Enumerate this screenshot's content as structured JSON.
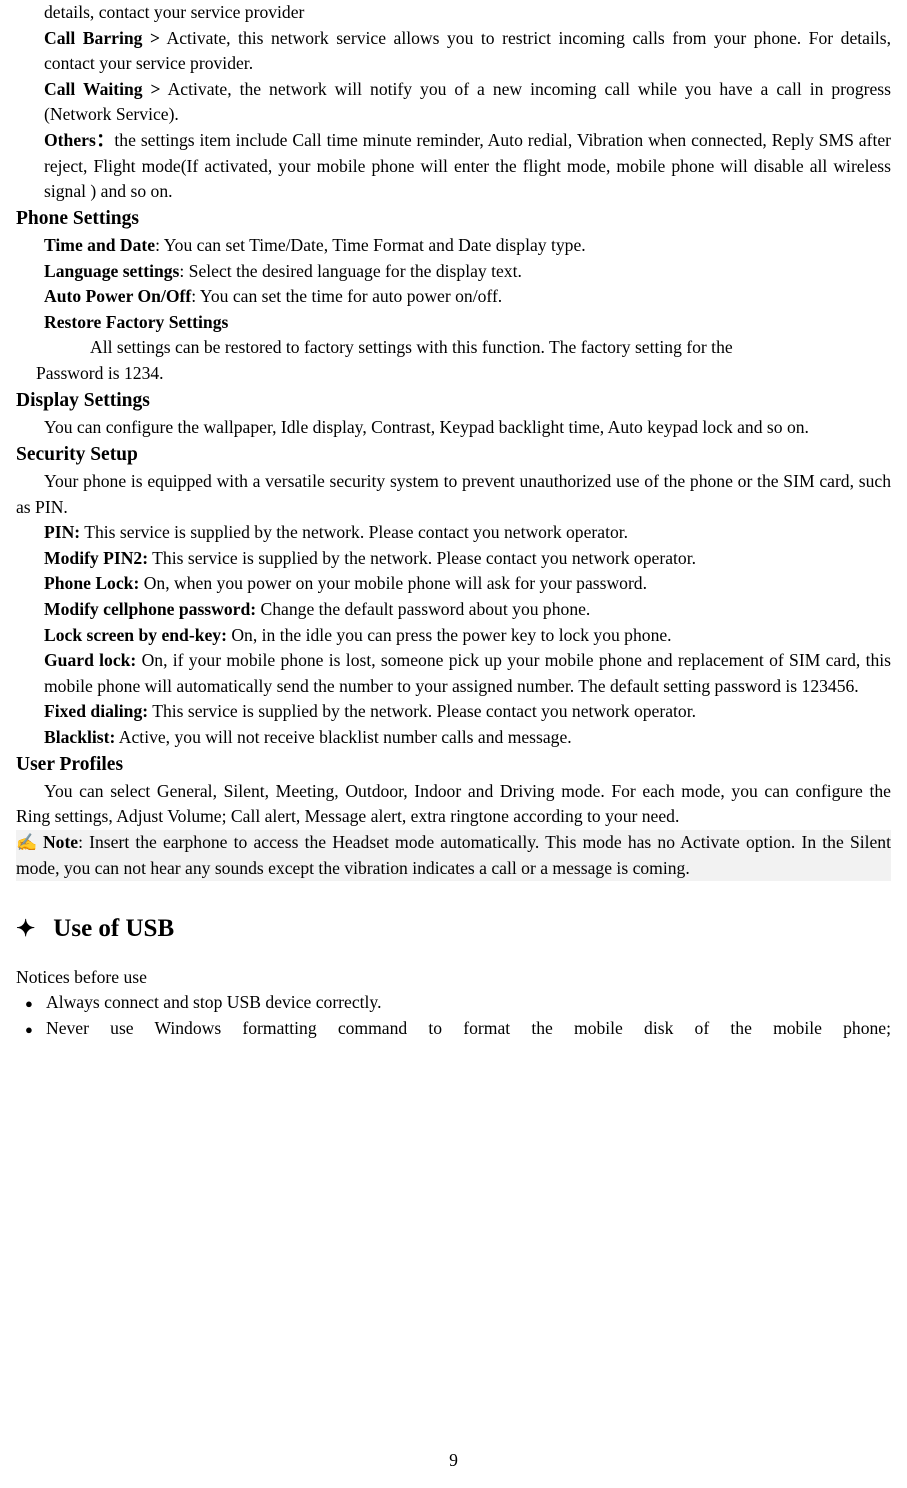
{
  "page": {
    "number": "9"
  },
  "content": {
    "line_continued": "details, contact your service provider",
    "call_settings": [
      {
        "term": "Call Barring >",
        "text": " Activate, this network service allows you to restrict incoming calls from your phone. For details, contact your service provider."
      },
      {
        "term": "Call Waiting >",
        "text": " Activate, the network will notify you of a new incoming call while you have a call in progress (Network Service)."
      },
      {
        "term": "Others：",
        "text": "the settings item include Call time minute reminder, Auto redial, Vibration when connected, Reply SMS after reject, Flight mode(If activated, your mobile phone will enter the flight mode, mobile phone will disable all wireless signal ) and so on."
      }
    ],
    "phone_settings": {
      "heading": "Phone Settings",
      "items": [
        {
          "term": "Time and Date",
          "text": ": You can set Time/Date, Time Format and Date display type."
        },
        {
          "term": "Language settings",
          "text": ": Select the desired language for the display text."
        },
        {
          "term": "Auto Power On/Off",
          "text": ": You can set the time for auto power on/off."
        },
        {
          "term": "Restore Factory Settings",
          "text": ""
        }
      ],
      "restore_body_line1": "All settings can be restored to factory settings with this function. The factory setting for the",
      "restore_body_line2": "Password is 1234."
    },
    "display_settings": {
      "heading": "Display Settings",
      "body": "You can configure the wallpaper, Idle display, Contrast, Keypad backlight time, Auto keypad lock and so on."
    },
    "security_setup": {
      "heading": "Security Setup",
      "body": "Your phone is equipped with a versatile security system to prevent unauthorized use of the phone or the SIM card, such as PIN.",
      "items": [
        {
          "term": "PIN:",
          "text": " This service is supplied by the network. Please contact you network operator."
        },
        {
          "term": "Modify PIN2:",
          "text": " This service is supplied by the network. Please contact you network operator."
        },
        {
          "term": "Phone Lock:",
          "text": " On, when you power on your mobile phone will ask for your password."
        },
        {
          "term": "Modify cellphone password:",
          "text": " Change the default password about you phone."
        },
        {
          "term": "Lock screen by end-key:",
          "text": " On, in the idle you can press the power key to lock you phone."
        },
        {
          "term": "Guard lock:",
          "text": " On, if your mobile phone is lost, someone pick up your mobile phone and replacement of SIM card, this mobile phone will automatically send the number to your assigned number. The default setting password is 123456."
        },
        {
          "term": "Fixed dialing:",
          "text": " This service is supplied by the network. Please contact you network operator."
        },
        {
          "term": "Blacklist:",
          "text": " Active, you will not receive blacklist number calls and message."
        }
      ]
    },
    "user_profiles": {
      "heading": "User Profiles",
      "body": "You can select General, Silent, Meeting, Outdoor, Indoor and Driving mode. For each mode, you can configure the Ring settings, Adjust Volume; Call alert, Message alert, extra ringtone according to your need.",
      "note_icon": "pencil-note-icon",
      "note_term": "Note",
      "note_text": ": Insert the earphone to access the Headset mode automatically. This mode has no Activate option. In the Silent mode, you can not hear any sounds except the vibration indicates a call or a message is coming."
    },
    "usb_section": {
      "bullet_icon": "diamond-bullet-icon",
      "heading": "Use of USB",
      "intro": "Notices before use",
      "bullets": [
        "Always connect and stop USB device correctly.",
        "Never use Windows formatting command to format the mobile disk of the mobile phone;"
      ]
    }
  }
}
